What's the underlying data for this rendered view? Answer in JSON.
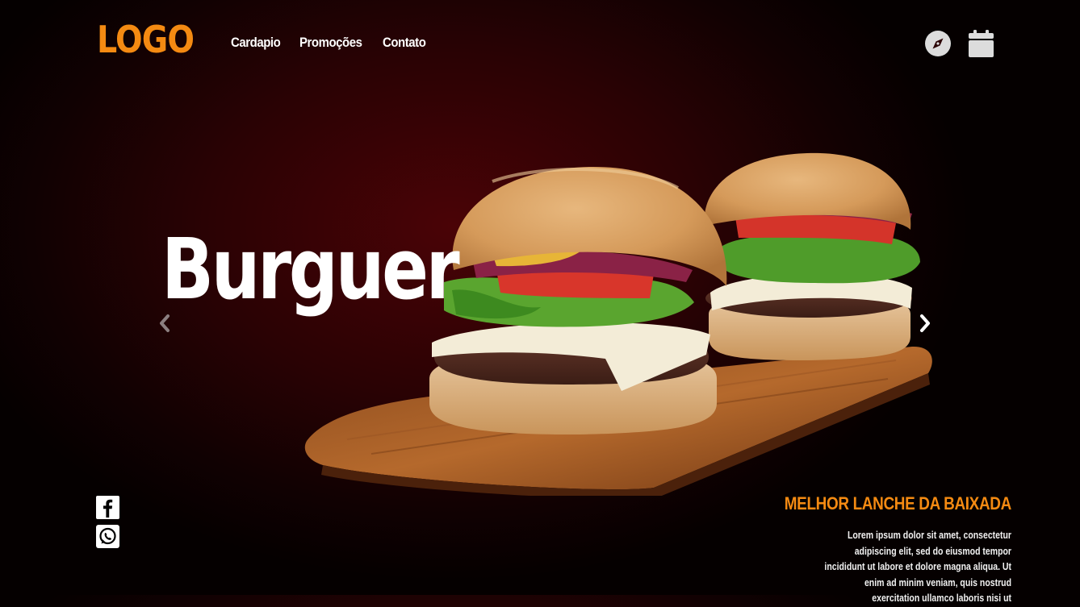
{
  "header": {
    "logo": "LOGO",
    "nav": [
      {
        "label": "Cardapio"
      },
      {
        "label": "Promoções"
      },
      {
        "label": "Contato"
      }
    ],
    "icons": [
      "compass-icon",
      "calendar-icon"
    ]
  },
  "hero": {
    "title": "Burguer",
    "image": "burger-image",
    "prev_icon": "chevron-left-icon",
    "next_icon": "chevron-right-icon"
  },
  "social": [
    "facebook-icon",
    "whatsapp-icon"
  ],
  "info": {
    "tagline": "MELHOR LANCHE DA BAIXADA",
    "description": "Lorem ipsum dolor sit amet, consectetur adipiscing elit, sed do eiusmod tempor incididunt ut labore et dolore magna aliqua. Ut enim ad minim veniam, quis nostrud exercitation ullamco laboris nisi ut"
  },
  "colors": {
    "accent": "#f48a12",
    "background": "#2a0204"
  }
}
